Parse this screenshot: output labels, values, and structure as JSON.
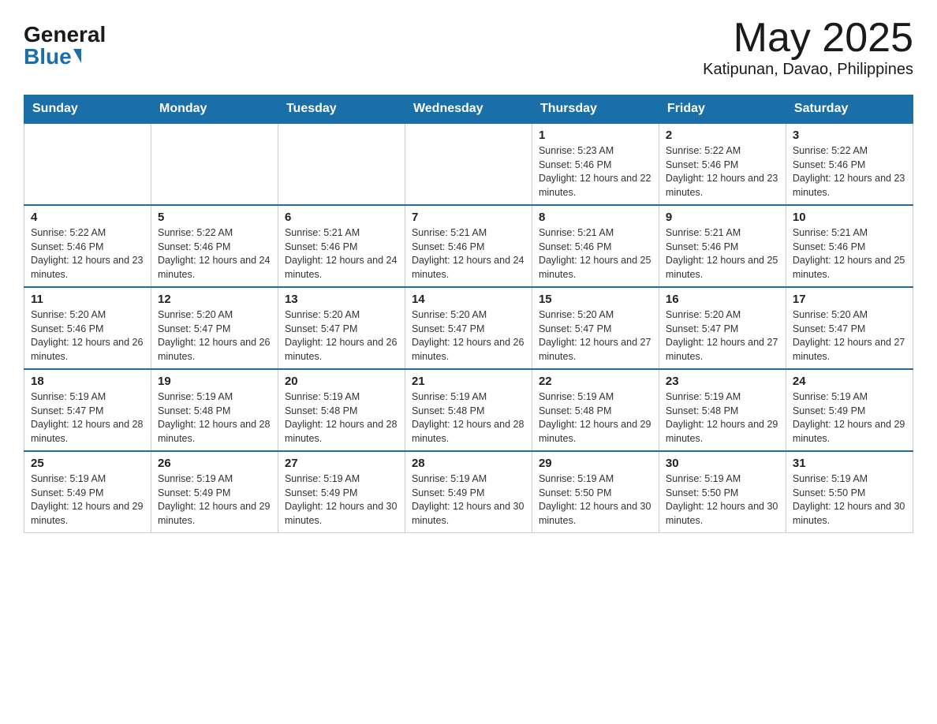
{
  "header": {
    "logo_general": "General",
    "logo_blue": "Blue",
    "month_title": "May 2025",
    "location": "Katipunan, Davao, Philippines"
  },
  "weekdays": [
    "Sunday",
    "Monday",
    "Tuesday",
    "Wednesday",
    "Thursday",
    "Friday",
    "Saturday"
  ],
  "weeks": [
    [
      {
        "day": "",
        "info": ""
      },
      {
        "day": "",
        "info": ""
      },
      {
        "day": "",
        "info": ""
      },
      {
        "day": "",
        "info": ""
      },
      {
        "day": "1",
        "info": "Sunrise: 5:23 AM\nSunset: 5:46 PM\nDaylight: 12 hours and 22 minutes."
      },
      {
        "day": "2",
        "info": "Sunrise: 5:22 AM\nSunset: 5:46 PM\nDaylight: 12 hours and 23 minutes."
      },
      {
        "day": "3",
        "info": "Sunrise: 5:22 AM\nSunset: 5:46 PM\nDaylight: 12 hours and 23 minutes."
      }
    ],
    [
      {
        "day": "4",
        "info": "Sunrise: 5:22 AM\nSunset: 5:46 PM\nDaylight: 12 hours and 23 minutes."
      },
      {
        "day": "5",
        "info": "Sunrise: 5:22 AM\nSunset: 5:46 PM\nDaylight: 12 hours and 24 minutes."
      },
      {
        "day": "6",
        "info": "Sunrise: 5:21 AM\nSunset: 5:46 PM\nDaylight: 12 hours and 24 minutes."
      },
      {
        "day": "7",
        "info": "Sunrise: 5:21 AM\nSunset: 5:46 PM\nDaylight: 12 hours and 24 minutes."
      },
      {
        "day": "8",
        "info": "Sunrise: 5:21 AM\nSunset: 5:46 PM\nDaylight: 12 hours and 25 minutes."
      },
      {
        "day": "9",
        "info": "Sunrise: 5:21 AM\nSunset: 5:46 PM\nDaylight: 12 hours and 25 minutes."
      },
      {
        "day": "10",
        "info": "Sunrise: 5:21 AM\nSunset: 5:46 PM\nDaylight: 12 hours and 25 minutes."
      }
    ],
    [
      {
        "day": "11",
        "info": "Sunrise: 5:20 AM\nSunset: 5:46 PM\nDaylight: 12 hours and 26 minutes."
      },
      {
        "day": "12",
        "info": "Sunrise: 5:20 AM\nSunset: 5:47 PM\nDaylight: 12 hours and 26 minutes."
      },
      {
        "day": "13",
        "info": "Sunrise: 5:20 AM\nSunset: 5:47 PM\nDaylight: 12 hours and 26 minutes."
      },
      {
        "day": "14",
        "info": "Sunrise: 5:20 AM\nSunset: 5:47 PM\nDaylight: 12 hours and 26 minutes."
      },
      {
        "day": "15",
        "info": "Sunrise: 5:20 AM\nSunset: 5:47 PM\nDaylight: 12 hours and 27 minutes."
      },
      {
        "day": "16",
        "info": "Sunrise: 5:20 AM\nSunset: 5:47 PM\nDaylight: 12 hours and 27 minutes."
      },
      {
        "day": "17",
        "info": "Sunrise: 5:20 AM\nSunset: 5:47 PM\nDaylight: 12 hours and 27 minutes."
      }
    ],
    [
      {
        "day": "18",
        "info": "Sunrise: 5:19 AM\nSunset: 5:47 PM\nDaylight: 12 hours and 28 minutes."
      },
      {
        "day": "19",
        "info": "Sunrise: 5:19 AM\nSunset: 5:48 PM\nDaylight: 12 hours and 28 minutes."
      },
      {
        "day": "20",
        "info": "Sunrise: 5:19 AM\nSunset: 5:48 PM\nDaylight: 12 hours and 28 minutes."
      },
      {
        "day": "21",
        "info": "Sunrise: 5:19 AM\nSunset: 5:48 PM\nDaylight: 12 hours and 28 minutes."
      },
      {
        "day": "22",
        "info": "Sunrise: 5:19 AM\nSunset: 5:48 PM\nDaylight: 12 hours and 29 minutes."
      },
      {
        "day": "23",
        "info": "Sunrise: 5:19 AM\nSunset: 5:48 PM\nDaylight: 12 hours and 29 minutes."
      },
      {
        "day": "24",
        "info": "Sunrise: 5:19 AM\nSunset: 5:49 PM\nDaylight: 12 hours and 29 minutes."
      }
    ],
    [
      {
        "day": "25",
        "info": "Sunrise: 5:19 AM\nSunset: 5:49 PM\nDaylight: 12 hours and 29 minutes."
      },
      {
        "day": "26",
        "info": "Sunrise: 5:19 AM\nSunset: 5:49 PM\nDaylight: 12 hours and 29 minutes."
      },
      {
        "day": "27",
        "info": "Sunrise: 5:19 AM\nSunset: 5:49 PM\nDaylight: 12 hours and 30 minutes."
      },
      {
        "day": "28",
        "info": "Sunrise: 5:19 AM\nSunset: 5:49 PM\nDaylight: 12 hours and 30 minutes."
      },
      {
        "day": "29",
        "info": "Sunrise: 5:19 AM\nSunset: 5:50 PM\nDaylight: 12 hours and 30 minutes."
      },
      {
        "day": "30",
        "info": "Sunrise: 5:19 AM\nSunset: 5:50 PM\nDaylight: 12 hours and 30 minutes."
      },
      {
        "day": "31",
        "info": "Sunrise: 5:19 AM\nSunset: 5:50 PM\nDaylight: 12 hours and 30 minutes."
      }
    ]
  ]
}
